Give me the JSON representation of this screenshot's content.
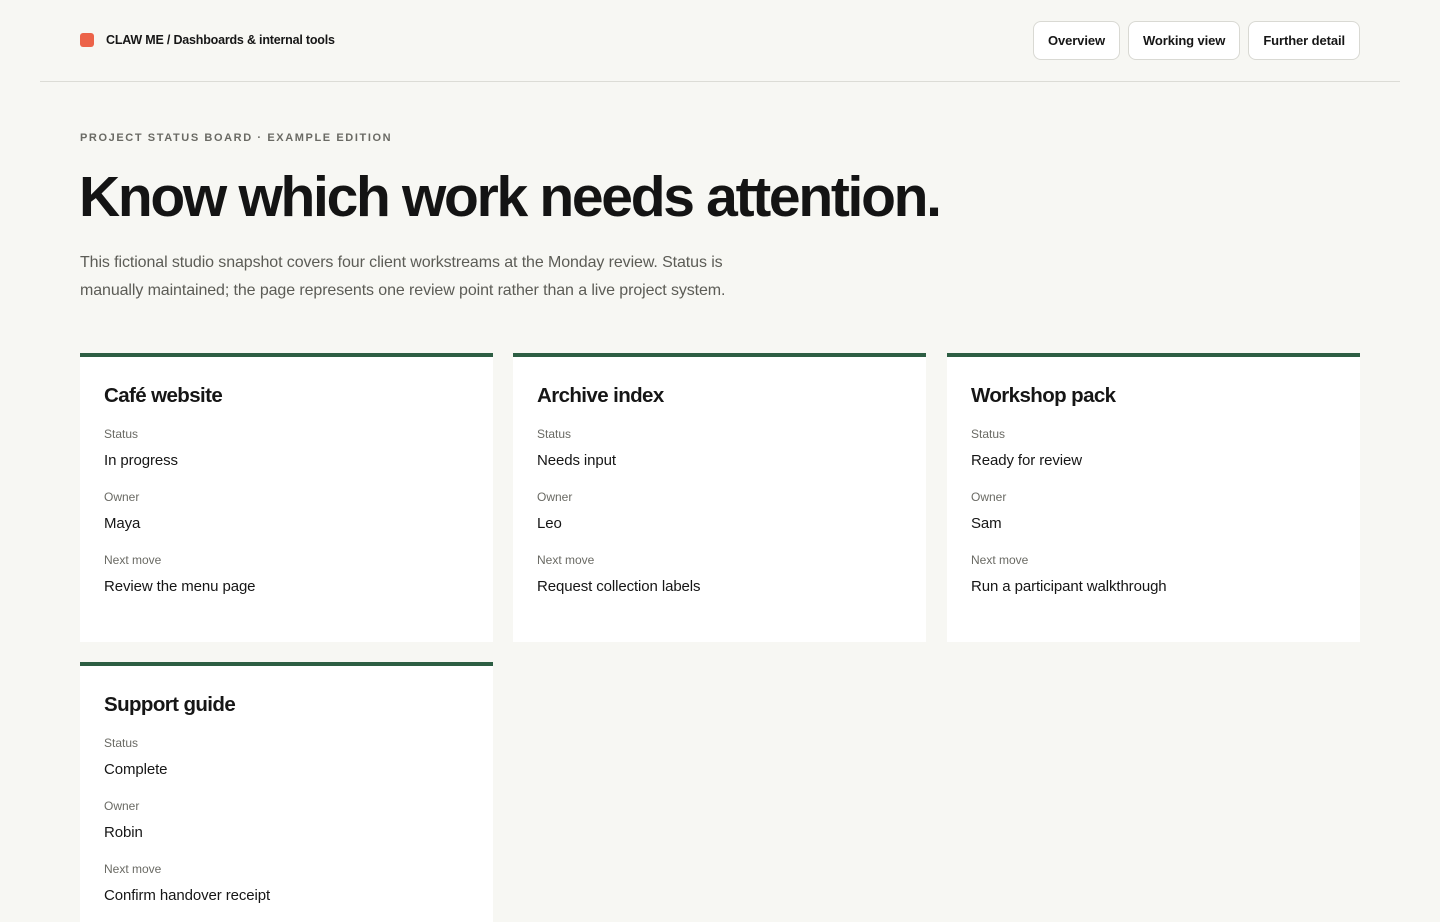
{
  "header": {
    "brand": "CLAW ME / Dashboards & internal tools",
    "nav": [
      "Overview",
      "Working view",
      "Further detail"
    ]
  },
  "hero": {
    "eyebrow": "PROJECT STATUS BOARD · EXAMPLE EDITION",
    "headline": "Know which work needs attention.",
    "intro": "This fictional studio snapshot covers four client workstreams at the Monday review. Status is manually maintained; the page represents one review point rather than a live project system."
  },
  "labels": {
    "status": "Status",
    "owner": "Owner",
    "next": "Next move"
  },
  "colors": {
    "accent": "#2d5e43",
    "brand_mark": "#ec6349",
    "background": "#f7f7f3"
  },
  "projects": [
    {
      "title": "Café website",
      "status": "In progress",
      "owner": "Maya",
      "next": "Review the menu page"
    },
    {
      "title": "Archive index",
      "status": "Needs input",
      "owner": "Leo",
      "next": "Request collection labels"
    },
    {
      "title": "Workshop pack",
      "status": "Ready for review",
      "owner": "Sam",
      "next": "Run a participant walkthrough"
    },
    {
      "title": "Support guide",
      "status": "Complete",
      "owner": "Robin",
      "next": "Confirm handover receipt"
    }
  ]
}
